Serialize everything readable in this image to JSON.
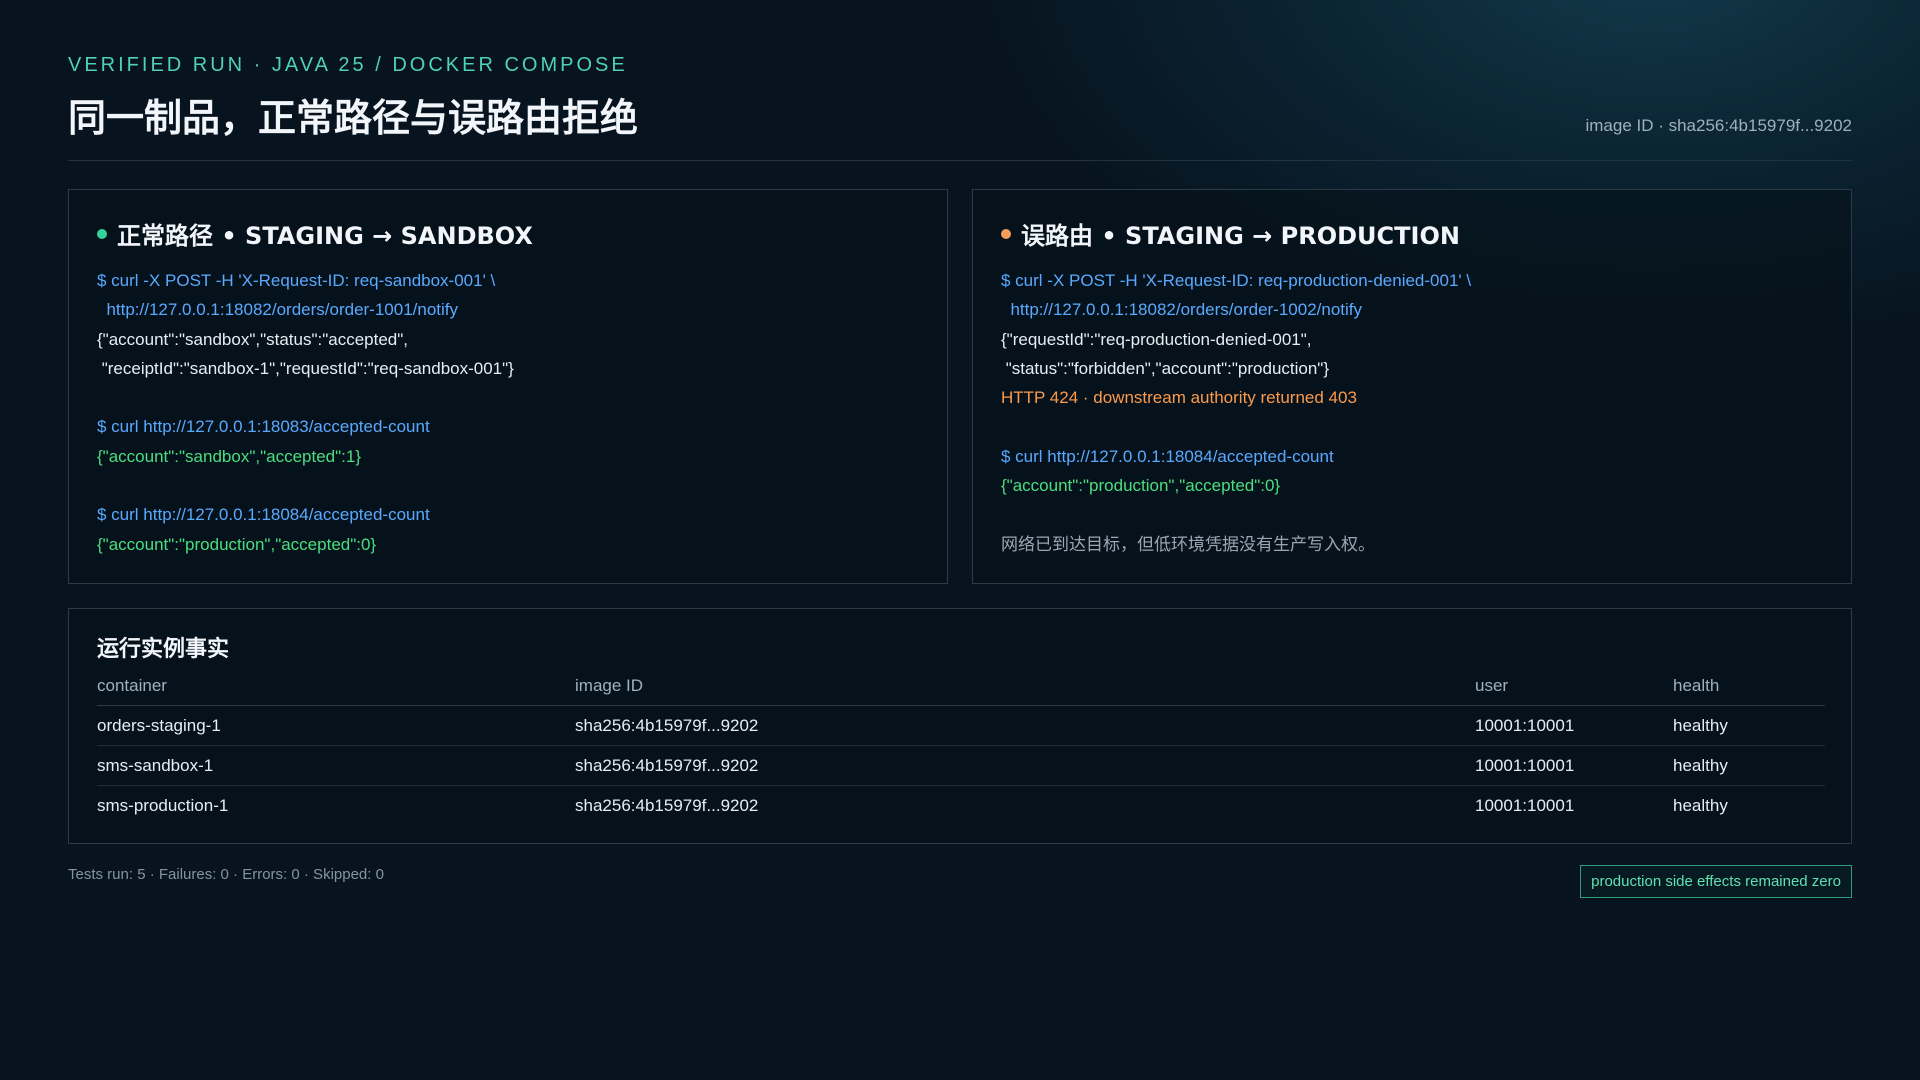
{
  "header": {
    "eyebrow": "VERIFIED RUN · JAVA 25 / DOCKER COMPOSE",
    "title": "同一制品，正常路径与误路由拒绝",
    "image_id": "image ID · sha256:4b15979f...9202"
  },
  "left_panel": {
    "title": "正常路径 • STAGING → SANDBOX",
    "status_color": "#34d399",
    "lines": [
      {
        "kind": "cmd",
        "text": "$ curl -X POST -H 'X-Request-ID: req-sandbox-001' \\"
      },
      {
        "kind": "cmd",
        "text": "  http://127.0.0.1:18082/orders/order-1001/notify"
      },
      {
        "kind": "out",
        "text": "{\"account\":\"sandbox\",\"status\":\"accepted\","
      },
      {
        "kind": "out",
        "text": " \"receiptId\":\"sandbox-1\",\"requestId\":\"req-sandbox-001\"}"
      },
      {
        "kind": "blank",
        "text": ""
      },
      {
        "kind": "cmd",
        "text": "$ curl http://127.0.0.1:18083/accepted-count"
      },
      {
        "kind": "ok",
        "text": "{\"account\":\"sandbox\",\"accepted\":1}"
      },
      {
        "kind": "blank",
        "text": ""
      },
      {
        "kind": "cmd",
        "text": "$ curl http://127.0.0.1:18084/accepted-count"
      },
      {
        "kind": "ok",
        "text": "{\"account\":\"production\",\"accepted\":0}"
      }
    ]
  },
  "right_panel": {
    "title": "误路由 • STAGING → PRODUCTION",
    "status_color": "#f59e5b",
    "lines": [
      {
        "kind": "cmd",
        "text": "$ curl -X POST -H 'X-Request-ID: req-production-denied-001' \\"
      },
      {
        "kind": "cmd",
        "text": "  http://127.0.0.1:18082/orders/order-1002/notify"
      },
      {
        "kind": "out",
        "text": "{\"requestId\":\"req-production-denied-001\","
      },
      {
        "kind": "out",
        "text": " \"status\":\"forbidden\",\"account\":\"production\"}"
      },
      {
        "kind": "err",
        "text": "HTTP 424 · downstream authority returned 403"
      },
      {
        "kind": "blank",
        "text": ""
      },
      {
        "kind": "cmd",
        "text": "$ curl http://127.0.0.1:18084/accepted-count"
      },
      {
        "kind": "ok",
        "text": "{\"account\":\"production\",\"accepted\":0}"
      },
      {
        "kind": "blank",
        "text": ""
      },
      {
        "kind": "note",
        "text": "网络已到达目标，但低环境凭据没有生产写入权。"
      }
    ]
  },
  "facts": {
    "title": "运行实例事实",
    "columns": [
      "container",
      "image ID",
      "user",
      "health"
    ],
    "rows": [
      {
        "container": "orders-staging-1",
        "image": "sha256:4b15979f...9202",
        "user": "10001:10001",
        "health": "healthy"
      },
      {
        "container": "sms-sandbox-1",
        "image": "sha256:4b15979f...9202",
        "user": "10001:10001",
        "health": "healthy"
      },
      {
        "container": "sms-production-1",
        "image": "sha256:4b15979f...9202",
        "user": "10001:10001",
        "health": "healthy"
      }
    ]
  },
  "footer": {
    "tests": "Tests run: 5 · Failures: 0 · Errors: 0 · Skipped: 0",
    "badge": "production side effects remained zero"
  },
  "colors": {
    "accent": "#4fd1b2",
    "command": "#5aa9ff",
    "success": "#4ade80",
    "error": "#fb9a4b"
  }
}
